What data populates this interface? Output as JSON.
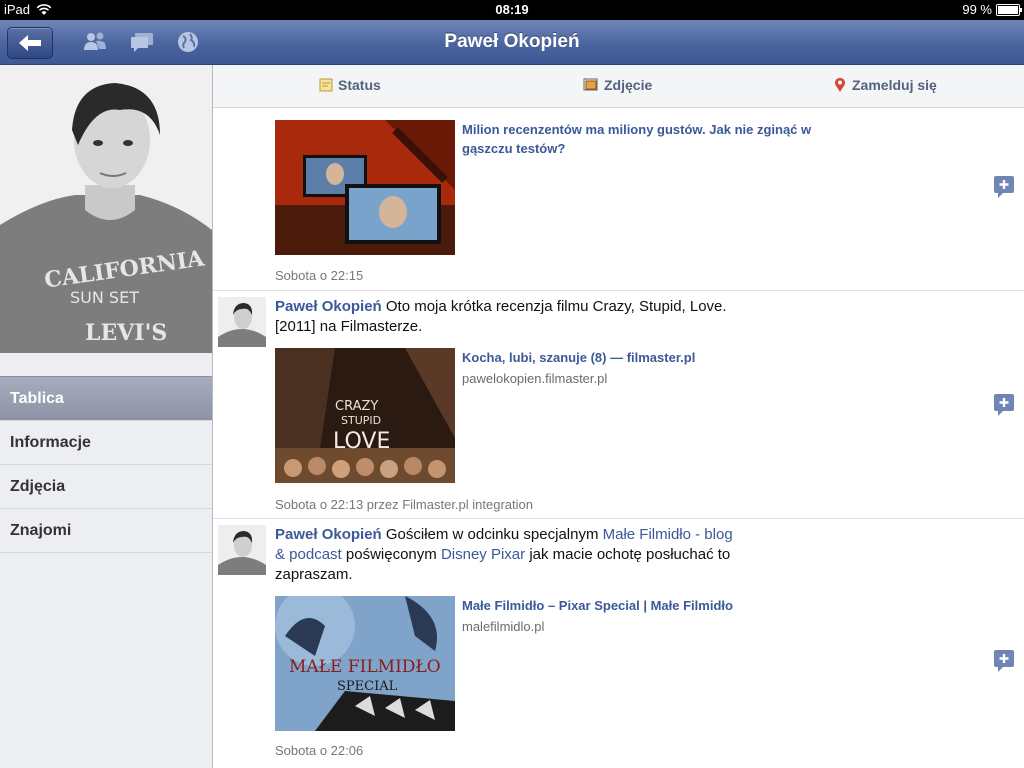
{
  "status_bar": {
    "device": "iPad",
    "time": "08:19",
    "battery": "99 %"
  },
  "nav": {
    "title": "Paweł Okopień"
  },
  "sidebar": {
    "items": [
      {
        "label": "Tablica",
        "active": true
      },
      {
        "label": "Informacje"
      },
      {
        "label": "Zdjęcia"
      },
      {
        "label": "Znajomi"
      }
    ]
  },
  "composer": {
    "status": "Status",
    "photo": "Zdjęcie",
    "checkin": "Zamelduj się"
  },
  "feed": {
    "posts": [
      {
        "link_title": "Milion recenzentów ma miliony gustów. Jak nie zginąć w gąszczu testów?",
        "timestamp": "Sobota o 22:15"
      },
      {
        "author": "Paweł Okopień",
        "text": "Oto moja krótka recenzja filmu Crazy, Stupid, Love. [2011] na Filmasterze.",
        "link_title": "Kocha, lubi, szanuje (8) — filmaster.pl",
        "link_domain": "pawelokopien.filmaster.pl",
        "thumb_text": [
          "CRAZY",
          "STUPID",
          "LOVE"
        ],
        "timestamp": "Sobota o 22:13 przez Filmaster.pl integration"
      },
      {
        "author": "Paweł Okopień",
        "text_1": "Gościłem w odcinku specjalnym",
        "link_1": "Małe Filmidło - blog & podcast",
        "text_2": "poświęconym",
        "link_2": "Disney Pixar",
        "text_3": "jak macie ochotę posłuchać to zapraszam.",
        "link_title": "Małe Filmidło – Pixar Special | Małe Filmidło",
        "link_domain": "malefilmidlo.pl",
        "thumb_text": [
          "MAŁE FILMIDŁO",
          "SPECIAL"
        ],
        "timestamp": "Sobota o 22:06"
      }
    ]
  },
  "icons": {
    "back": "back-arrow-icon",
    "friends": "friends-icon",
    "messages": "messages-icon",
    "notifications": "globe-icon",
    "add": "add-comment-icon"
  }
}
